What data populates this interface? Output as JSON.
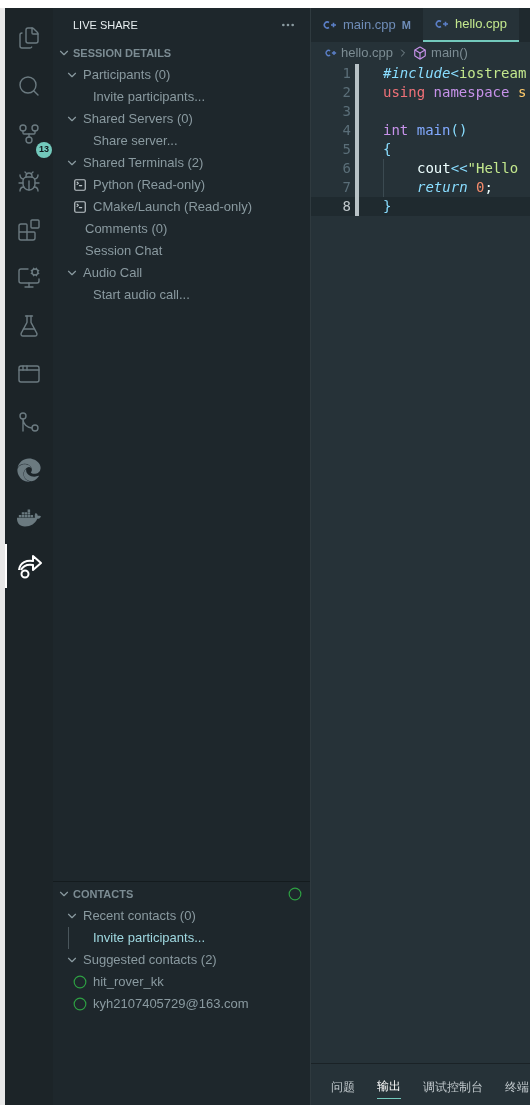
{
  "activity_bar": {
    "items": [
      {
        "selected": false
      },
      {
        "selected": false
      },
      {
        "selected": false,
        "badge": "13"
      },
      {
        "selected": false
      },
      {
        "selected": false
      },
      {
        "selected": false
      },
      {
        "selected": false
      },
      {
        "selected": false
      },
      {
        "selected": false
      },
      {
        "selected": false
      },
      {
        "selected": false
      },
      {
        "selected": true
      }
    ]
  },
  "sidebar": {
    "title": "LIVE SHARE",
    "session_details": {
      "title": "SESSION DETAILS",
      "expanded": true,
      "items": [
        {
          "label": "Participants (0)",
          "kind": "group",
          "expanded": true,
          "children": [
            {
              "label": "Invite participants...",
              "kind": "action"
            }
          ]
        },
        {
          "label": "Shared Servers (0)",
          "kind": "group",
          "expanded": true,
          "children": [
            {
              "label": "Share server...",
              "kind": "action"
            }
          ]
        },
        {
          "label": "Shared Terminals (2)",
          "kind": "group",
          "expanded": true,
          "children": [
            {
              "label": "Python (Read-only)",
              "kind": "terminal"
            },
            {
              "label": "CMake/Launch (Read-only)",
              "kind": "terminal"
            }
          ]
        },
        {
          "label": "Comments (0)",
          "kind": "item"
        },
        {
          "label": "Session Chat",
          "kind": "item"
        },
        {
          "label": "Audio Call",
          "kind": "group",
          "expanded": true,
          "children": [
            {
              "label": "Start audio call...",
              "kind": "action"
            }
          ]
        }
      ]
    },
    "contacts": {
      "title": "CONTACTS",
      "expanded": true,
      "items": [
        {
          "label": "Recent contacts (0)",
          "kind": "group",
          "expanded": true,
          "children": [
            {
              "label": "Invite participants...",
              "kind": "link"
            }
          ]
        },
        {
          "label": "Suggested contacts (2)",
          "kind": "group",
          "expanded": true,
          "children": [
            {
              "label": "hit_rover_kk",
              "kind": "contact"
            },
            {
              "label": "kyh2107405729@163.com",
              "kind": "contact"
            }
          ]
        }
      ]
    }
  },
  "editor": {
    "tabs": [
      {
        "label": "main.cpp",
        "badge": "M",
        "selected": false
      },
      {
        "label": "hello.cpp",
        "selected": true
      }
    ],
    "breadcrumb": [
      "hello.cpp",
      "main()"
    ],
    "lines": [
      {
        "number": "1",
        "current": false,
        "tokens": [
          {
            "text": "#include",
            "kind": "directive"
          },
          {
            "text": "<",
            "kind": "punct"
          },
          {
            "text": "iostream",
            "kind": "string"
          }
        ]
      },
      {
        "number": "2",
        "current": false,
        "tokens": [
          {
            "text": "using",
            "kind": "keyword2"
          },
          {
            "text": " namespace",
            "kind": "keyword"
          },
          {
            "text": " s",
            "kind": "type"
          }
        ]
      },
      {
        "number": "3",
        "current": false
      },
      {
        "number": "4",
        "current": false,
        "tokens": [
          {
            "text": "int",
            "kind": "keyword"
          },
          {
            "text": " main",
            "kind": "function"
          },
          {
            "text": "()",
            "kind": "punct"
          }
        ]
      },
      {
        "number": "5",
        "current": false,
        "tokens": [
          {
            "text": "{",
            "kind": "punct"
          }
        ]
      },
      {
        "number": "6",
        "current": false,
        "indent": true,
        "tokens": [
          {
            "text": "cout",
            "kind": "plain"
          },
          {
            "text": "<<",
            "kind": "punct"
          },
          {
            "text": "\"Hello",
            "kind": "string"
          }
        ]
      },
      {
        "number": "7",
        "current": false,
        "indent": true,
        "tokens": [
          {
            "text": "return",
            "kind": "control"
          },
          {
            "text": " 0",
            "kind": "number"
          },
          {
            "text": ";",
            "kind": "plain"
          }
        ]
      },
      {
        "number": "8",
        "current": true,
        "tokens": [
          {
            "text": "}",
            "kind": "punct"
          }
        ]
      }
    ]
  },
  "panel": {
    "tabs": [
      {
        "label": "问题",
        "selected": false
      },
      {
        "label": "输出",
        "selected": true
      },
      {
        "label": "调试控制台",
        "selected": false
      },
      {
        "label": "终端",
        "selected": false
      }
    ]
  }
}
